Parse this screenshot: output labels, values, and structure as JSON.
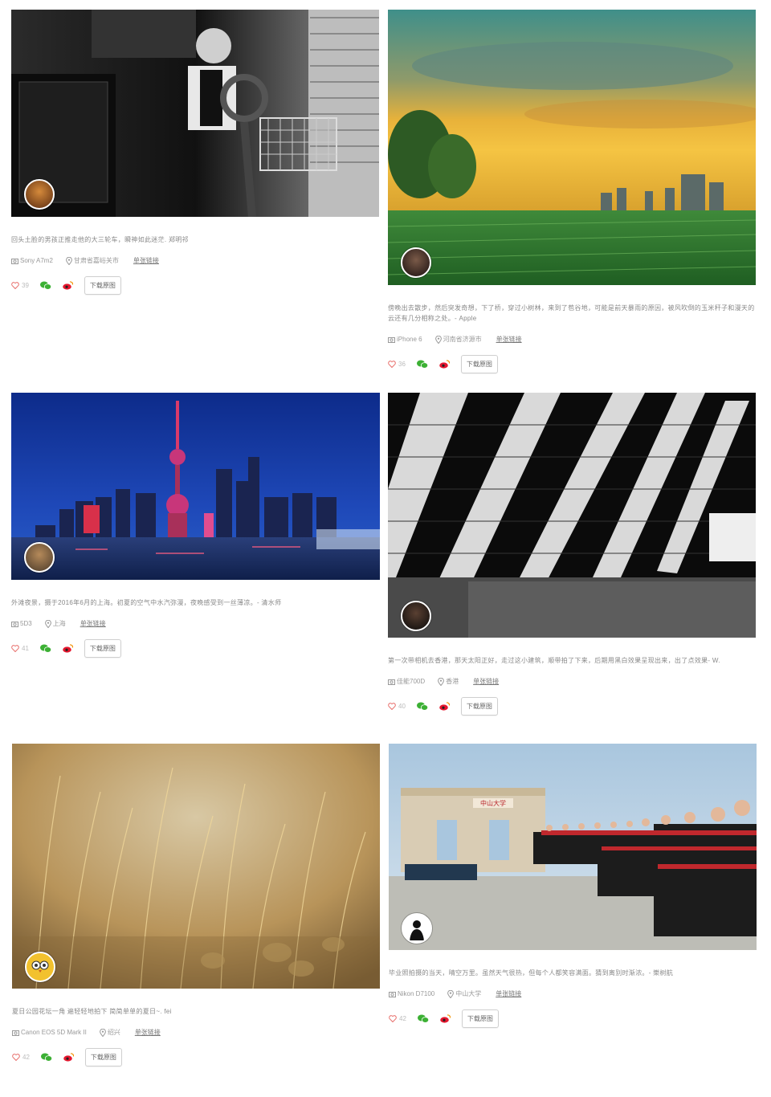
{
  "cards": [
    {
      "caption": "回头土脸的男孩正推走他的大三轮车，瞬神如此迷茫. 郑明祁",
      "camera": "Sony A7m2",
      "location": "甘肃省嘉峪关市",
      "link": "单张链接",
      "likes": "39",
      "download": "下载原图"
    },
    {
      "caption": "傍晚出去散步，然后突发奇想，下了桥，穿过小树林，来到了苞谷地，可能是前天暴雨的原因，被风吹倒的玉米秆子和漫天的云还有几分相称之处。- Apple",
      "camera": "iPhone 6",
      "location": "河南省济源市",
      "link": "单张链接",
      "likes": "36",
      "download": "下载原图"
    },
    {
      "caption": "外滩夜景，摄于2016年6月的上海。初夏的空气中水汽弥漫，夜晚感受到一丝薄凉。- 清水师",
      "camera": "5D3",
      "location": "上海",
      "link": "单张链接",
      "likes": "41",
      "download": "下载原图"
    },
    {
      "caption": "第一次带相机去香港，那天太阳正好，走过这小建筑，顺带拍了下来，后期用黑白效果呈现出来，出了点效果- W.",
      "camera": "佳能700D",
      "location": "香港",
      "link": "单张链接",
      "likes": "40",
      "download": "下载原图"
    },
    {
      "caption": "夏日公园花坛一角 遍轻轻地拍下 简简单单的夏日~. fei",
      "camera": "Canon EOS 5D Mark II",
      "location": "绍兴",
      "link": "单张链接",
      "likes": "42",
      "download": "下载原图"
    },
    {
      "caption": "毕业照拍摄的当天，晴空万里。虽然天气很热，但每个人都笑容满面。猜到离别时渐浓。- 樂树航",
      "camera": "Nikon D7100",
      "location": "中山大学",
      "link": "单张链接",
      "likes": "42",
      "download": "下载原图"
    }
  ],
  "photo_sign": "中山大学",
  "colors": {
    "like": "#e8706c",
    "wechat": "#3cb034",
    "weibo": "#e6162d"
  }
}
